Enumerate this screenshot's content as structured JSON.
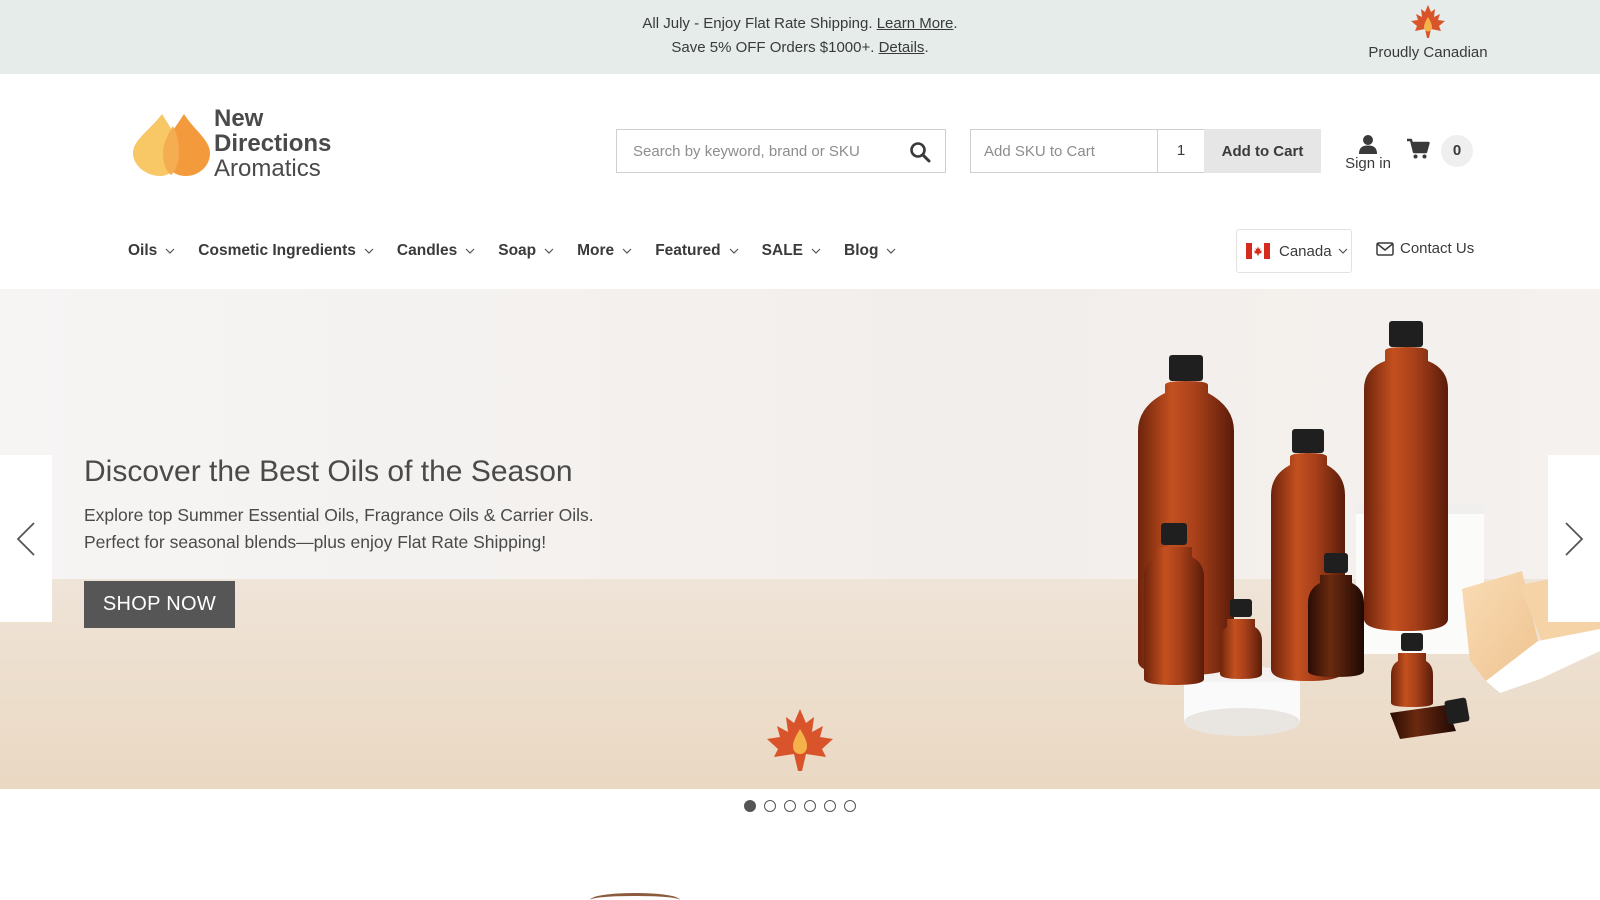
{
  "announcement": {
    "line1_text": "All July - Enjoy Flat Rate Shipping. ",
    "line1_link": "Learn More",
    "line1_suffix": ".",
    "line2_text": "Save 5% OFF Orders $1000+. ",
    "line2_link": "Details",
    "line2_suffix": ".",
    "proud_label": "Proudly Canadian"
  },
  "logo": {
    "line1": "New",
    "line2": "Directions",
    "line3": "Aromatics"
  },
  "header": {
    "search_placeholder": "Search by keyword, brand or SKU",
    "sku_placeholder": "Add SKU to Cart",
    "qty_value": "1",
    "add_to_cart_label": "Add to Cart",
    "sign_in_label": "Sign in",
    "cart_count": "0"
  },
  "nav": {
    "items": [
      {
        "label": "Oils"
      },
      {
        "label": "Cosmetic Ingredients"
      },
      {
        "label": "Candles"
      },
      {
        "label": "Soap"
      },
      {
        "label": "More"
      },
      {
        "label": "Featured"
      },
      {
        "label": "SALE"
      },
      {
        "label": "Blog"
      }
    ],
    "country_label": "Canada",
    "contact_label": "Contact Us"
  },
  "hero": {
    "title": "Discover the Best Oils of the Season",
    "desc_line1": "Explore top Summer Essential Oils, Fragrance Oils & Carrier Oils.",
    "desc_line2": "Perfect for seasonal blends—plus enjoy Flat Rate Shipping!",
    "cta_label": "SHOP NOW",
    "slide_count": 6,
    "active_slide": 1
  },
  "colors": {
    "announcement_bg": "#e5ecea",
    "cta_bg": "#565656",
    "maple_red": "#d9542b",
    "drop_orange": "#f39a3d",
    "drop_yellow": "#f8c766"
  }
}
